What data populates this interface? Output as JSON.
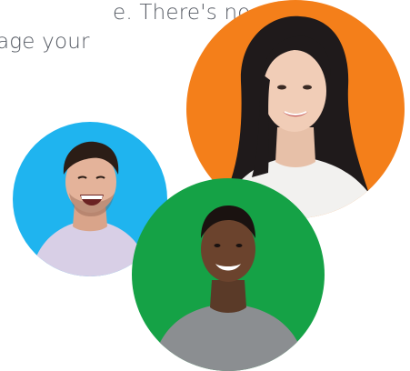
{
  "copy": {
    "line1": "e. There's no",
    "line2": "age your"
  },
  "avatars": [
    {
      "name": "avatar-woman",
      "background": "#f47f1a"
    },
    {
      "name": "avatar-man-laughing",
      "background": "#1fb4ef"
    },
    {
      "name": "avatar-man-smiling",
      "background": "#15a246"
    }
  ]
}
